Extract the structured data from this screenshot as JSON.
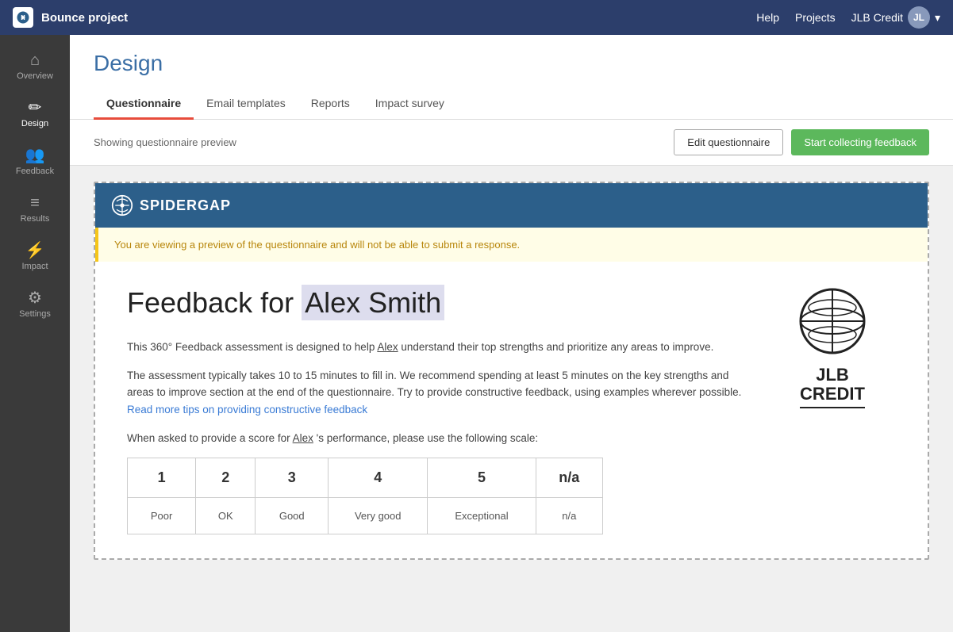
{
  "app": {
    "title": "Bounce project",
    "nav_links": [
      "Help",
      "Projects"
    ],
    "user_label": "JLB Credit",
    "user_initials": "JL"
  },
  "sidebar": {
    "items": [
      {
        "id": "overview",
        "label": "Overview",
        "icon": "home"
      },
      {
        "id": "design",
        "label": "Design",
        "icon": "pencil",
        "active": true
      },
      {
        "id": "feedback",
        "label": "Feedback",
        "icon": "people"
      },
      {
        "id": "results",
        "label": "Results",
        "icon": "chart"
      },
      {
        "id": "impact",
        "label": "Impact",
        "icon": "bolt"
      },
      {
        "id": "settings",
        "label": "Settings",
        "icon": "gear"
      }
    ]
  },
  "page": {
    "title": "Design",
    "tabs": [
      {
        "id": "questionnaire",
        "label": "Questionnaire",
        "active": true
      },
      {
        "id": "email-templates",
        "label": "Email templates"
      },
      {
        "id": "reports",
        "label": "Reports"
      },
      {
        "id": "impact-survey",
        "label": "Impact survey"
      }
    ],
    "toolbar": {
      "info": "Showing questionnaire preview",
      "edit_label": "Edit questionnaire",
      "collect_label": "Start collecting feedback"
    }
  },
  "preview": {
    "header": {
      "brand": "Spidergap"
    },
    "warning": "You are viewing a preview of the questionnaire and will not be able to submit a response.",
    "feedback_title_prefix": "Feedback for",
    "subject_name": "Alex Smith",
    "description1": "This 360° Feedback assessment is designed to help Alex understand their top strengths and prioritize any areas to improve.",
    "description2_part1": "The assessment typically takes 10 to 15 minutes to fill in. We recommend spending at least 5 minutes on the key strengths and areas to improve section at the end of the questionnaire. Try to provide constructive feedback, using examples wherever possible.",
    "description2_link": "Read more tips on providing constructive feedback",
    "description2_link_href": "#",
    "description3_prefix": "When asked to provide a score for",
    "description3_name": "Alex",
    "description3_suffix": "'s performance, please use the following scale:",
    "score_table": {
      "numbers": [
        "1",
        "2",
        "3",
        "4",
        "5",
        "n/a"
      ],
      "labels": [
        "Poor",
        "OK",
        "Good",
        "Very good",
        "Exceptional",
        "n/a"
      ]
    },
    "company": {
      "name_line1": "JLB",
      "name_line2": "CREDIT"
    }
  }
}
